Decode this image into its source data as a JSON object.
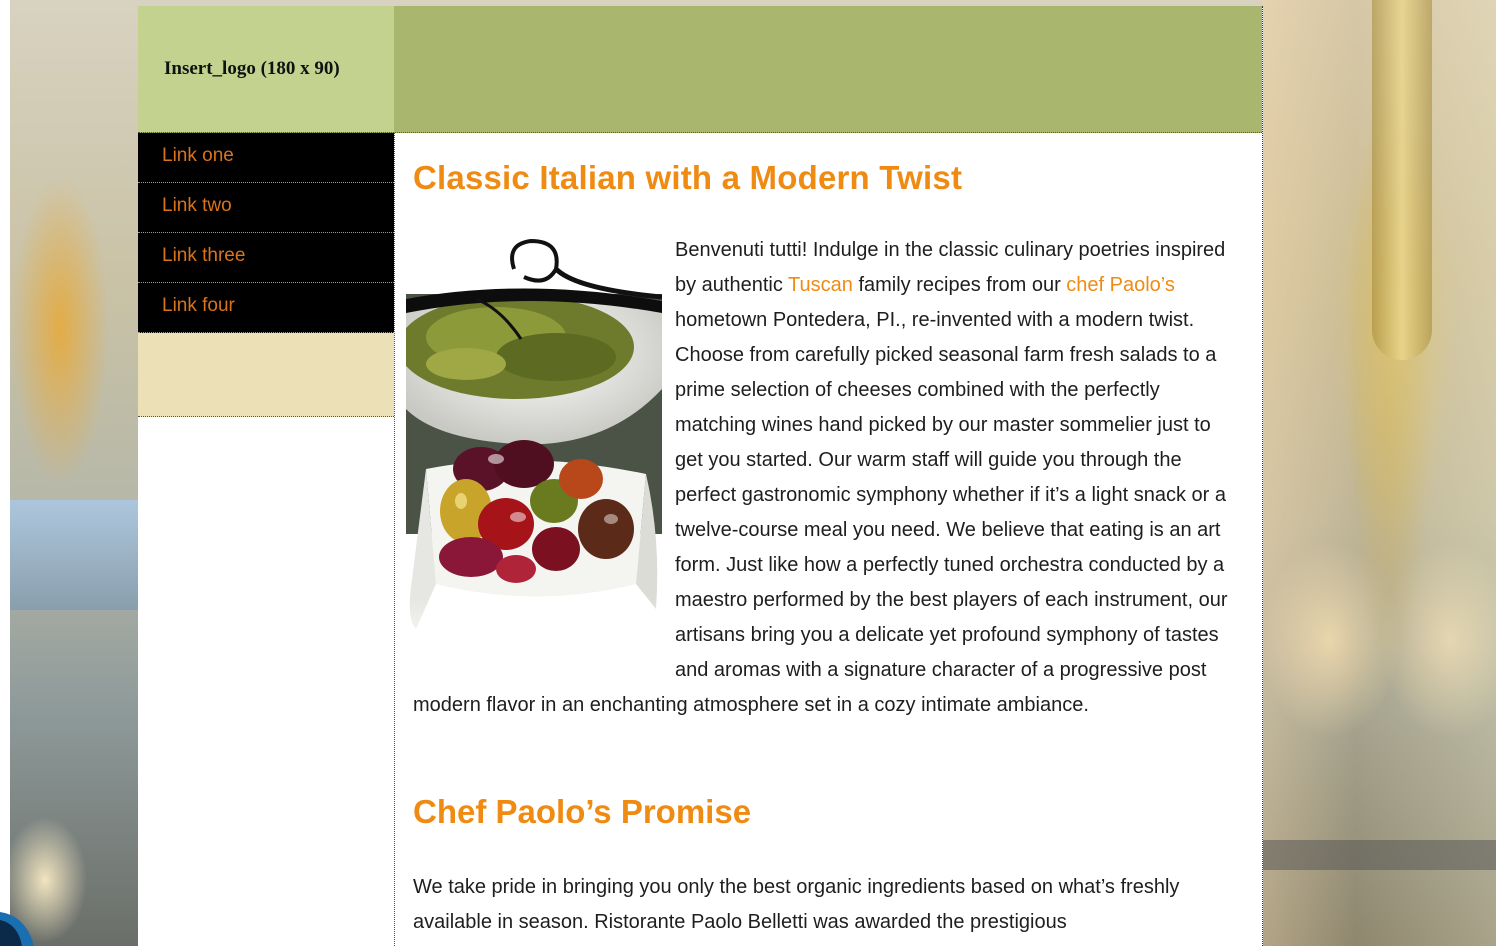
{
  "header": {
    "logo_placeholder": "Insert_logo (180 x 90)"
  },
  "nav": {
    "items": [
      {
        "label": "Link one"
      },
      {
        "label": "Link two"
      },
      {
        "label": "Link three"
      },
      {
        "label": "Link four"
      }
    ]
  },
  "main": {
    "title": "Classic Italian with a Modern Twist",
    "intro": {
      "part1": "Benvenuti tutti! Indulge in the classic culinary poetries inspired by authentic ",
      "link_tuscan": "Tuscan",
      "part2": " family recipes from our ",
      "link_chef": "chef Paolo’s",
      "part3": " hometown Pontedera, PI., re-invented with a modern twist.  Choose from carefully picked seasonal farm fresh salads to a prime selection of cheeses combined with the perfectly matching wines hand picked by our master sommelier just to get you started.  Our warm staff will guide you through the perfect gastronomic symphony whether if it’s a light snack or a twelve-course meal you need.  We believe that eating is an art form.  Just like how a perfectly tuned orchestra conducted by a maestro performed by the best players of each instrument, our artisans bring you a delicate yet profound symphony of tastes and aromas with a signature character of a progressive post modern flavor in an enchanting atmosphere set in a cozy intimate ambiance."
    },
    "subtitle": "Chef Paolo’s Promise",
    "promise": "We take pride in bringing you only the best organic ingredients based on what’s freshly available in season.  Ristorante Paolo Belletti was awarded the prestigious"
  },
  "colors": {
    "accent": "#ef8b12",
    "header_bg": "#a9b66e",
    "logo_bg": "#c3d38f",
    "nav_bg": "#000000",
    "sidebar_tan": "#ebe0b6"
  },
  "icons": {
    "photo": "olives-bowl-image"
  }
}
